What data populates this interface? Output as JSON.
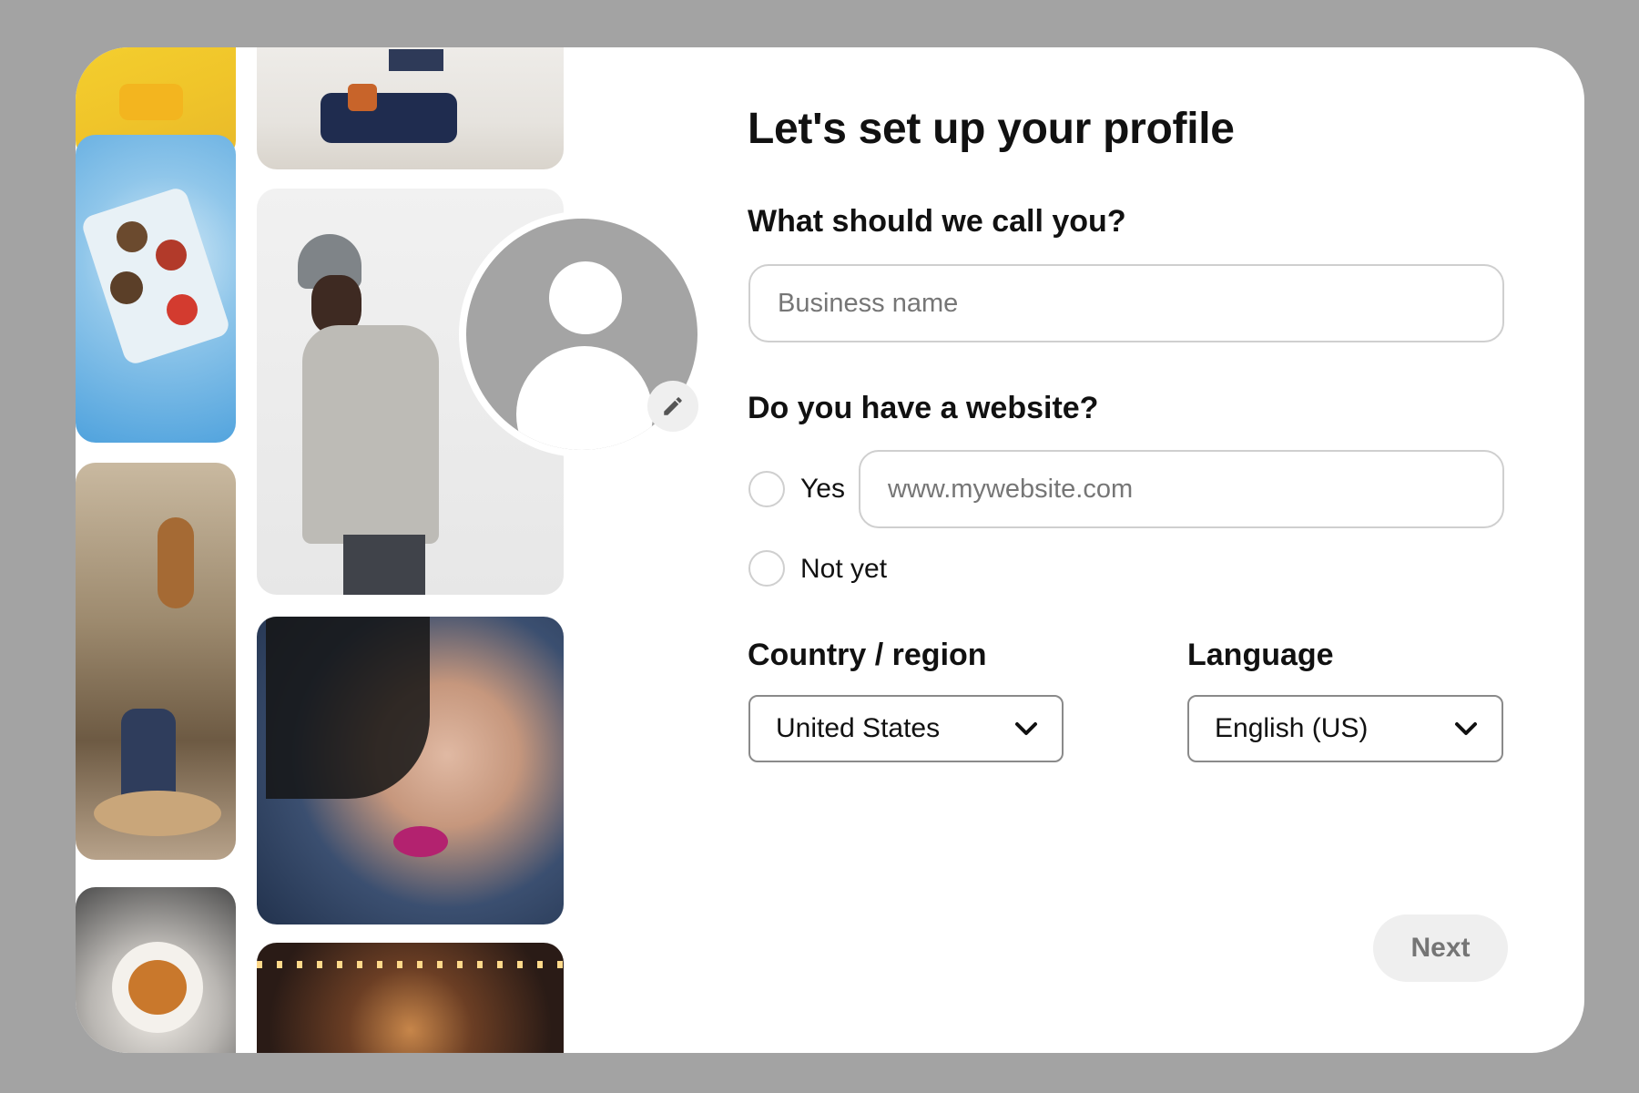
{
  "form": {
    "title": "Let's set up your profile",
    "name_question": "What should we call you?",
    "name_placeholder": "Business name",
    "website_question": "Do you have a website?",
    "website_yes_label": "Yes",
    "website_placeholder": "www.mywebsite.com",
    "website_no_label": "Not yet",
    "country_label": "Country / region",
    "country_value": "United States",
    "language_label": "Language",
    "language_value": "English (US)",
    "next_label": "Next"
  },
  "avatar": {
    "placeholder_icon": "default-user-icon",
    "edit_icon": "pencil-icon"
  },
  "colors": {
    "page_background": "#a3a3a3",
    "card_background": "#ffffff",
    "avatar_gray": "#a4a4a4",
    "next_button_bg": "#efefef",
    "next_button_text": "#757575"
  }
}
